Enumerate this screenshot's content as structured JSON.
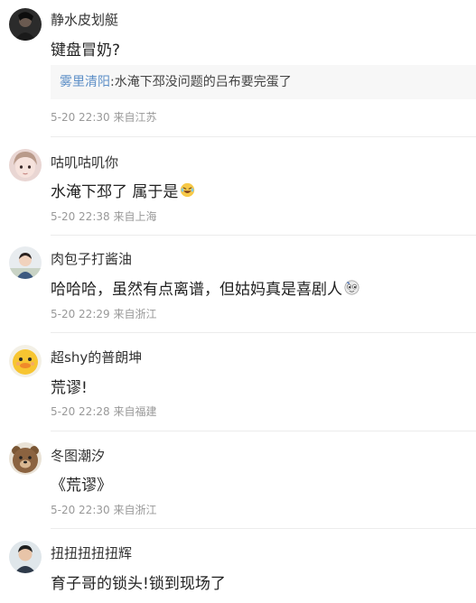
{
  "comments": [
    {
      "username": "静水皮划艇",
      "text": "键盘冒奶?",
      "quote": {
        "user": "雾里清阳",
        "text": ":水淹下邳没问题的吕布要完蛋了"
      },
      "time": "5-20 22:30",
      "location": "来自江苏",
      "avatar_icon": "dark-portrait-avatar"
    },
    {
      "username": "咕叽咕叽你",
      "text": "水淹下邳了 属于是",
      "emoji": "laughing-emoji-icon",
      "time": "5-20 22:38",
      "location": "来自上海",
      "avatar_icon": "girl-face-avatar"
    },
    {
      "username": "肉包子打酱油",
      "text": "哈哈哈，虽然有点离谱，但姑妈真是喜剧人",
      "emoji": "doge-emoji-icon",
      "time": "5-20 22:29",
      "location": "来自浙江",
      "avatar_icon": "child-photo-avatar"
    },
    {
      "username": "超shy的普朗坤",
      "text": "荒谬!",
      "time": "5-20 22:28",
      "location": "来自福建",
      "avatar_icon": "yellow-duck-avatar"
    },
    {
      "username": "冬图潮汐",
      "text": "《荒谬》",
      "time": "5-20 22:30",
      "location": "来自浙江",
      "avatar_icon": "brown-bear-avatar"
    },
    {
      "username": "扭扭扭扭扭辉",
      "text": "育子哥的锁头!锁到现场了",
      "avatar_icon": "man-portrait-avatar"
    }
  ],
  "colors": {
    "link_blue": "#5d8fc7",
    "meta_gray": "#999999",
    "quote_bg": "#f7f7f7",
    "divider": "#ececec"
  }
}
